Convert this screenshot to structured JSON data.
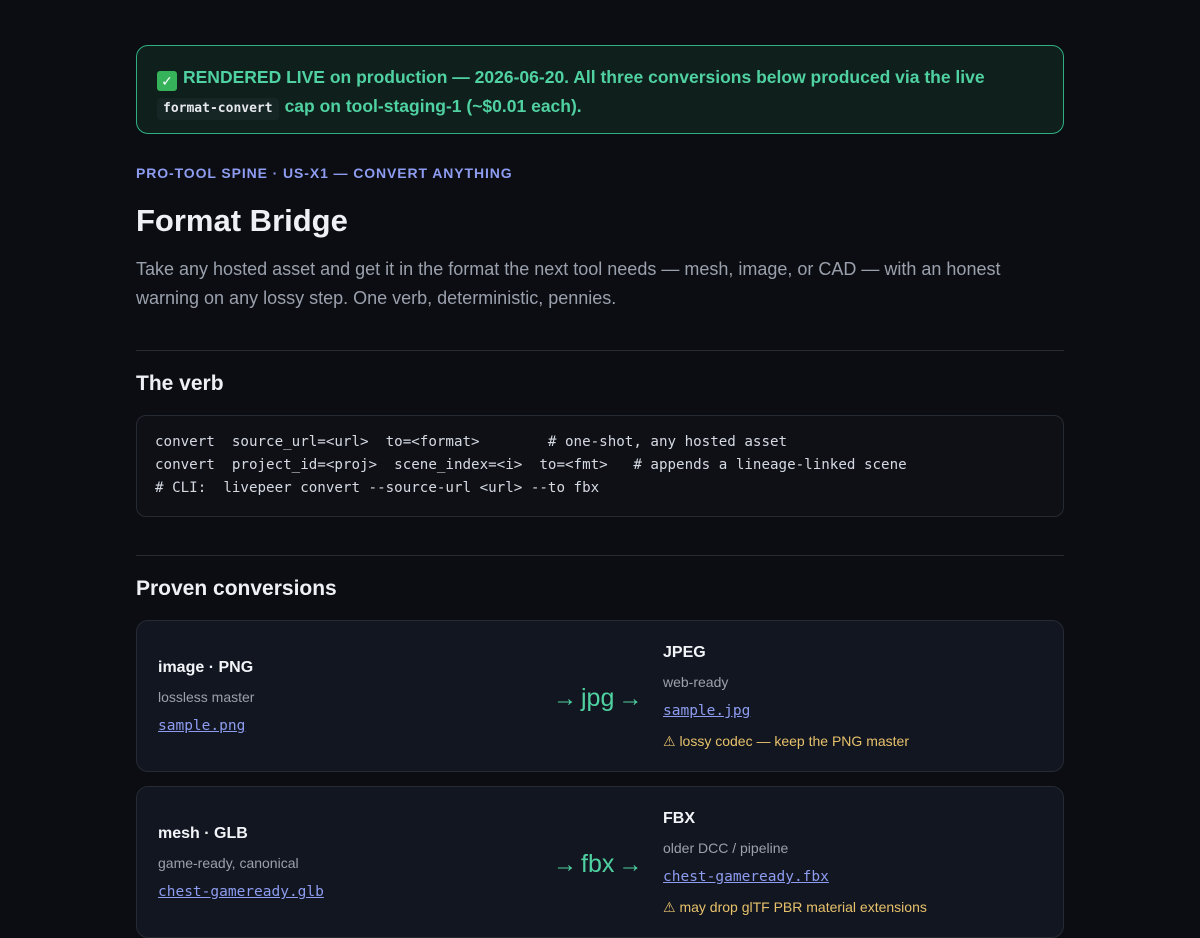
{
  "banner": {
    "check_icon": "check-mark-icon",
    "text_part1": "RENDERED LIVE on production — 2026-06-20. All three conversions below produced via the live",
    "code": "format-convert",
    "text_part2": "cap on tool-staging-1 (~$0.01 each)."
  },
  "eyebrow": "PRO-TOOL SPINE · US-X1 — CONVERT ANYTHING",
  "title": "Format Bridge",
  "lead": "Take any hosted asset and get it in the format the next tool needs — mesh, image, or CAD — with an honest warning on any lossy step. One verb, deterministic, pennies.",
  "verb_section": {
    "heading": "The verb",
    "code_lines": [
      "convert  source_url=<url>  to=<format>        # one-shot, any hosted asset",
      "convert  project_id=<proj>  scene_index=<i>  to=<fmt>   # appends a lineage-linked scene",
      "# CLI:  livepeer convert --source-url <url> --to fbx"
    ]
  },
  "conversions_section": {
    "heading": "Proven conversions",
    "cards": [
      {
        "source_kind": "image · PNG",
        "source_sub": "lossless master",
        "source_file": "sample.png",
        "arrow_left": "→",
        "target_fmt": "jpg",
        "arrow_right": "→",
        "target_name": "JPEG",
        "target_sub": "web-ready",
        "target_file": "sample.jpg",
        "warning": "⚠ lossy codec — keep the PNG master"
      },
      {
        "source_kind": "mesh · GLB",
        "source_sub": "game-ready, canonical",
        "source_file": "chest-gameready.glb",
        "arrow_left": "→",
        "target_fmt": "fbx",
        "arrow_right": "→",
        "target_name": "FBX",
        "target_sub": "older DCC / pipeline",
        "target_file": "chest-gameready.fbx",
        "warning": "⚠ may drop glTF PBR material extensions"
      }
    ]
  },
  "colors": {
    "background": "#0b0d12",
    "accent_green": "#4fd1a1",
    "accent_blue": "#8d9cf0",
    "warning": "#e7c16b"
  }
}
